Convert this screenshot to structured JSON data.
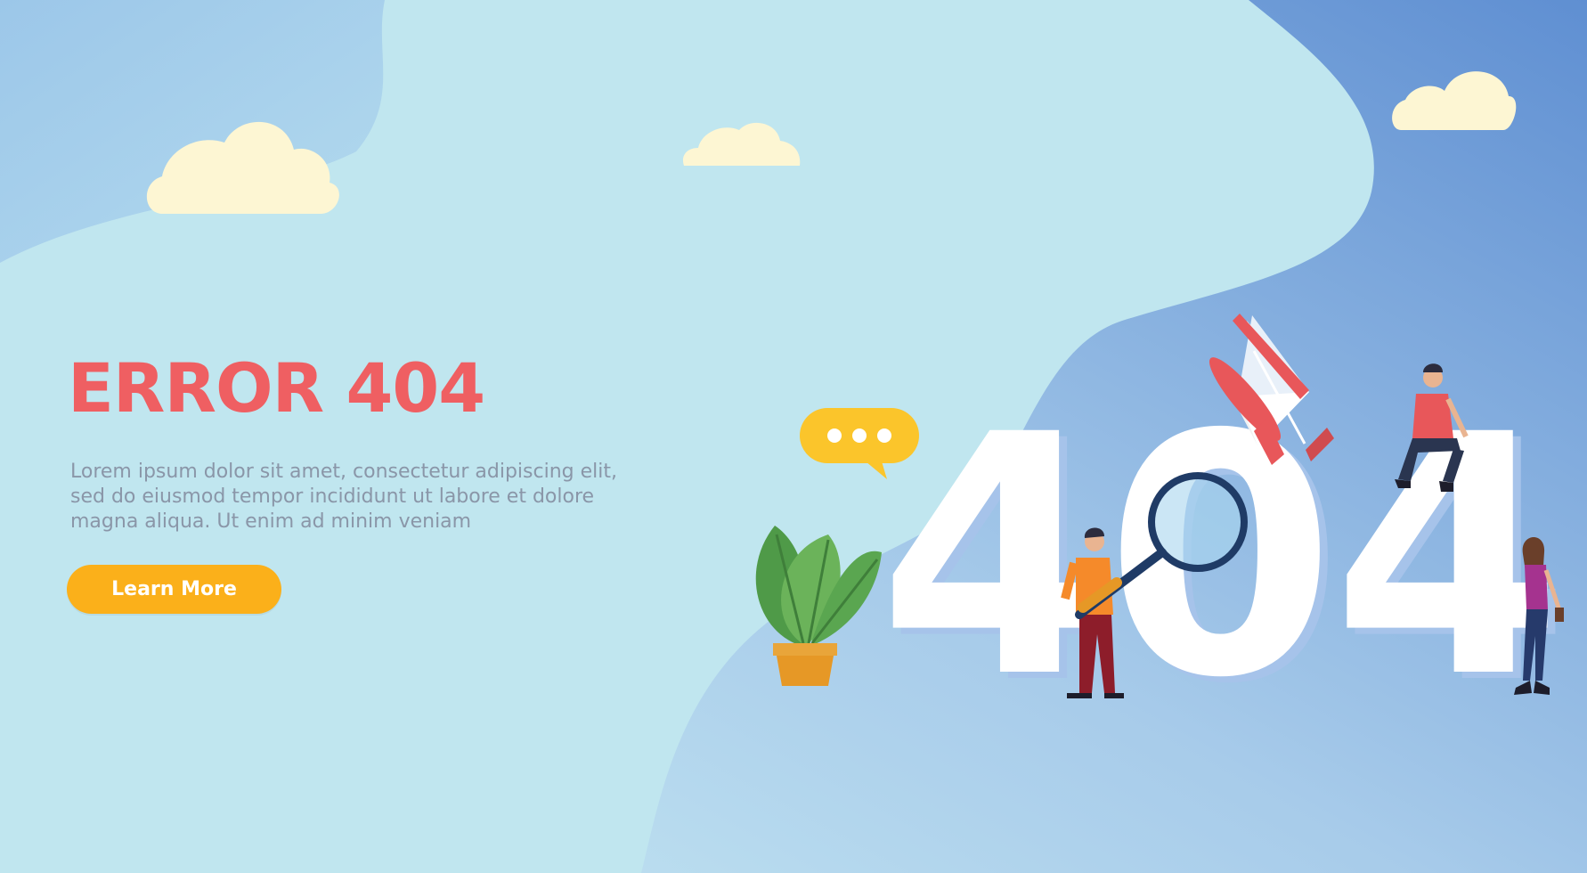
{
  "hero": {
    "title": "ERROR 404",
    "description": "Lorem ipsum dolor sit amet, consectetur adipiscing elit,\nsed do eiusmod tempor incididunt ut labore et dolore\nmagna aliqua. Ut enim ad minim veniam",
    "cta_label": "Learn More"
  },
  "illustration": {
    "big_text": "404",
    "icons": [
      "cloud-icon",
      "speech-bubble-icon",
      "potted-plant-icon",
      "megaphone-icon",
      "magnifying-glass-icon",
      "person-figure"
    ]
  },
  "colors": {
    "title": "#ef5f62",
    "body_text": "#8a96a8",
    "cta_background": "#fbb01a",
    "cta_text": "#ffffff",
    "background_light": "#c0e6ef",
    "background_dark": "#6d9ad6",
    "cloud": "#fdf6d3"
  }
}
